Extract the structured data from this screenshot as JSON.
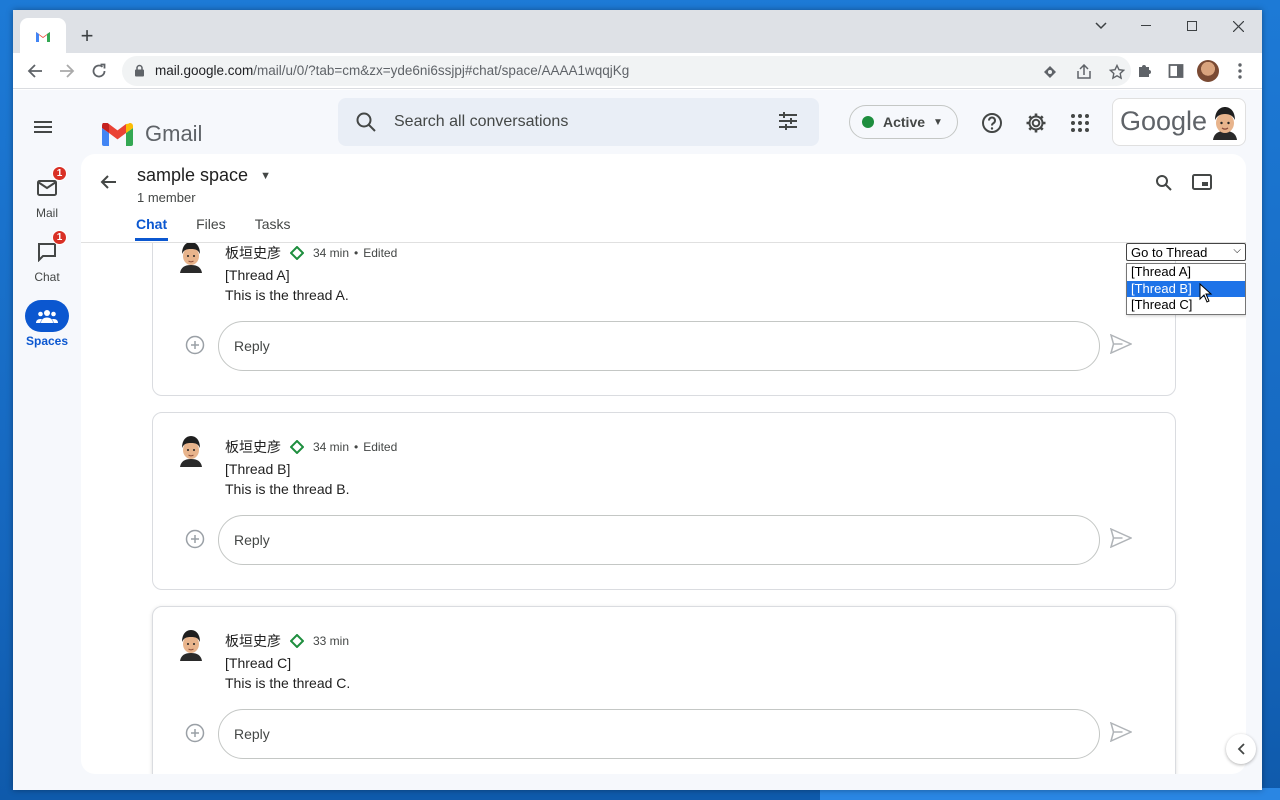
{
  "browser": {
    "url_host": "mail.google.com",
    "url_rest": "/mail/u/0/?tab=cm&zx=yde6ni6ssjpj#chat/space/AAAA1wqqjKg"
  },
  "header": {
    "app_name": "Gmail",
    "search_placeholder": "Search all conversations",
    "status_label": "Active",
    "account_brand": "Google"
  },
  "rail": {
    "mail": {
      "label": "Mail",
      "badge": "1"
    },
    "chat": {
      "label": "Chat",
      "badge": "1"
    },
    "spaces": {
      "label": "Spaces"
    }
  },
  "space": {
    "title": "sample space",
    "subtitle": "1 member",
    "tabs": [
      "Chat",
      "Files",
      "Tasks"
    ]
  },
  "goto_thread": {
    "label": "Go to Thread",
    "options": [
      "[Thread A]",
      "[Thread B]",
      "[Thread C]"
    ],
    "highlighted": "[Thread B]"
  },
  "threads": [
    {
      "author": "板垣史彦",
      "time": "34 min",
      "edited": "Edited",
      "line1": "[Thread A]",
      "line2": "This is the thread A.",
      "reply_placeholder": "Reply"
    },
    {
      "author": "板垣史彦",
      "time": "34 min",
      "edited": "Edited",
      "line1": "[Thread B]",
      "line2": "This is the thread B.",
      "reply_placeholder": "Reply"
    },
    {
      "author": "板垣史彦",
      "time": "33 min",
      "edited": "",
      "line1": "[Thread C]",
      "line2": "This is the thread C.",
      "reply_placeholder": "Reply"
    }
  ],
  "colors": {
    "accent": "#0b57d0",
    "badge": "#d93025",
    "active_dot": "#1e8e3e"
  }
}
